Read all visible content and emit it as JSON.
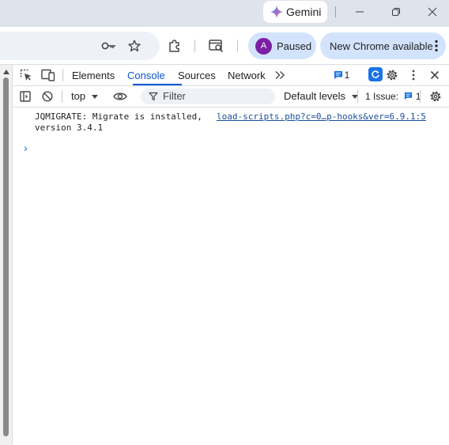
{
  "window": {
    "gemini_label": "Gemini"
  },
  "toolbar": {
    "profile_initial": "A",
    "profile_status": "Paused",
    "update_label": "New Chrome available"
  },
  "devtools": {
    "tabs": [
      "Elements",
      "Console",
      "Sources",
      "Network"
    ],
    "active_tab": "Console",
    "issues_badge_count": "1",
    "context": "top",
    "filter_placeholder": "Filter",
    "levels_label": "Default levels",
    "issues_label": "1 Issue:",
    "issues_count": "1"
  },
  "console": {
    "messages": [
      {
        "text_line1": "JQMIGRATE: Migrate is installed,",
        "text_line2": "version 3.4.1",
        "source": "load-scripts.php?c=0…p-hooks&ver=6.9.1:5"
      }
    ],
    "prompt_symbol": "›"
  },
  "colors": {
    "accent": "#0b57d0",
    "chip": "#d3e3fd",
    "titlebar": "#dfe3eb"
  }
}
